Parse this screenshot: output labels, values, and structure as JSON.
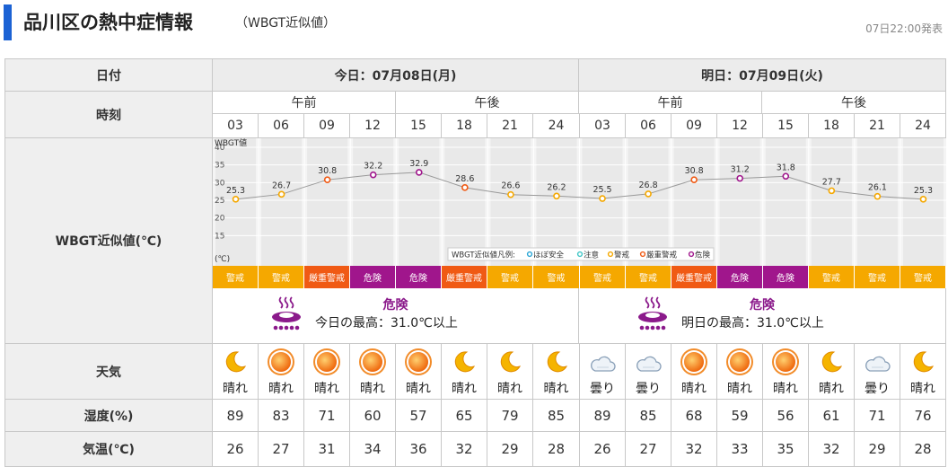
{
  "header": {
    "title": "品川区の熱中症情報",
    "subtitle": "（WBGT近似値）",
    "issued": "07日22:00発表"
  },
  "table": {
    "date_label": "日付",
    "time_label": "時刻",
    "wbgt_label": "WBGT近似値(℃)",
    "weather_label": "天気",
    "humidity_label": "湿度(%)",
    "temp_label": "気温(℃)",
    "days": [
      {
        "label": "今日：07月08日(月)",
        "am": "午前",
        "pm": "午後",
        "summary_level": "危険",
        "summary_max": "今日の最高：31.0℃以上"
      },
      {
        "label": "明日：07月09日(火)",
        "am": "午前",
        "pm": "午後",
        "summary_level": "危険",
        "summary_max": "明日の最高：31.0℃以上"
      }
    ],
    "hours": [
      "03",
      "06",
      "09",
      "12",
      "15",
      "18",
      "21",
      "24",
      "03",
      "06",
      "09",
      "12",
      "15",
      "18",
      "21",
      "24"
    ],
    "weather": [
      {
        "icon": "moon-icon",
        "label": "晴れ"
      },
      {
        "icon": "sun-icon",
        "label": "晴れ"
      },
      {
        "icon": "sun-icon",
        "label": "晴れ"
      },
      {
        "icon": "sun-icon",
        "label": "晴れ"
      },
      {
        "icon": "sun-icon",
        "label": "晴れ"
      },
      {
        "icon": "moon-icon",
        "label": "晴れ"
      },
      {
        "icon": "moon-icon",
        "label": "晴れ"
      },
      {
        "icon": "moon-icon",
        "label": "晴れ"
      },
      {
        "icon": "cloud-icon",
        "label": "曇り"
      },
      {
        "icon": "cloud-icon",
        "label": "曇り"
      },
      {
        "icon": "sun-icon",
        "label": "晴れ"
      },
      {
        "icon": "sun-icon",
        "label": "晴れ"
      },
      {
        "icon": "sun-icon",
        "label": "晴れ"
      },
      {
        "icon": "moon-icon",
        "label": "晴れ"
      },
      {
        "icon": "cloud-icon",
        "label": "曇り"
      },
      {
        "icon": "moon-icon",
        "label": "晴れ"
      }
    ],
    "humidity": [
      "89",
      "83",
      "71",
      "60",
      "57",
      "65",
      "79",
      "85",
      "89",
      "85",
      "68",
      "59",
      "56",
      "61",
      "71",
      "76"
    ],
    "temperature": [
      "26",
      "27",
      "31",
      "34",
      "36",
      "32",
      "29",
      "28",
      "26",
      "27",
      "32",
      "33",
      "35",
      "32",
      "29",
      "28"
    ],
    "levels": [
      "警戒",
      "警戒",
      "厳重警戒",
      "危険",
      "危険",
      "厳重警戒",
      "警戒",
      "警戒",
      "警戒",
      "警戒",
      "厳重警戒",
      "危険",
      "危険",
      "警戒",
      "警戒",
      "警戒"
    ]
  },
  "level_colors": {
    "ほぼ安全": "#2ba6d6",
    "注意": "#3fc6c6",
    "警戒": "#f5a800",
    "厳重警戒": "#f05a14",
    "危険": "#a0168c"
  },
  "chart_data": {
    "type": "line",
    "ylabel": "WBGT値",
    "yunit": "(℃)",
    "ylim": [
      10,
      40
    ],
    "yticks": [
      15,
      20,
      25,
      30,
      35,
      40
    ],
    "grid": true,
    "categories": [
      "03",
      "06",
      "09",
      "12",
      "15",
      "18",
      "21",
      "24",
      "03",
      "06",
      "09",
      "12",
      "15",
      "18",
      "21",
      "24"
    ],
    "values": [
      25.3,
      26.7,
      30.8,
      32.2,
      32.9,
      28.6,
      26.6,
      26.2,
      25.5,
      26.8,
      30.8,
      31.2,
      31.8,
      27.7,
      26.1,
      25.3
    ],
    "legend_title": "WBGT近似値凡例:",
    "legend": [
      "ほぼ安全",
      "注意",
      "警戒",
      "厳重警戒",
      "危険"
    ],
    "legend_position": "bottom-right"
  }
}
